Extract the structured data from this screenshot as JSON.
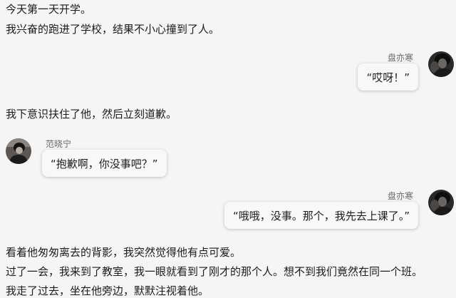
{
  "narration": {
    "line1": "今天第一天开学。",
    "line2": "我兴奋的跑进了学校，结果不小心撞到了人。",
    "line3": "我下意识扶住了他，然后立刻道歉。",
    "line4": "看着他匆匆离去的背影，我突然觉得他有点可爱。",
    "line5": "过了一会，我来到了教室，我一眼就看到了刚才的那个人。想不到我们竟然在同一个班。",
    "line6": "我走了过去，坐在他旁边，默默注视着他。"
  },
  "messages": [
    {
      "sender": "盘亦寒",
      "side": "right",
      "text": "“哎呀！”"
    },
    {
      "sender": "范晓宁",
      "side": "left",
      "text": "“抱歉啊，你没事吧？”"
    },
    {
      "sender": "盘亦寒",
      "side": "right",
      "text": "“哦哦，没事。那个，我先去上课了。”"
    }
  ],
  "colors": {
    "background": "#f5f5f5",
    "bubble": "#f8f8f8",
    "name": "#6b6b6b"
  }
}
